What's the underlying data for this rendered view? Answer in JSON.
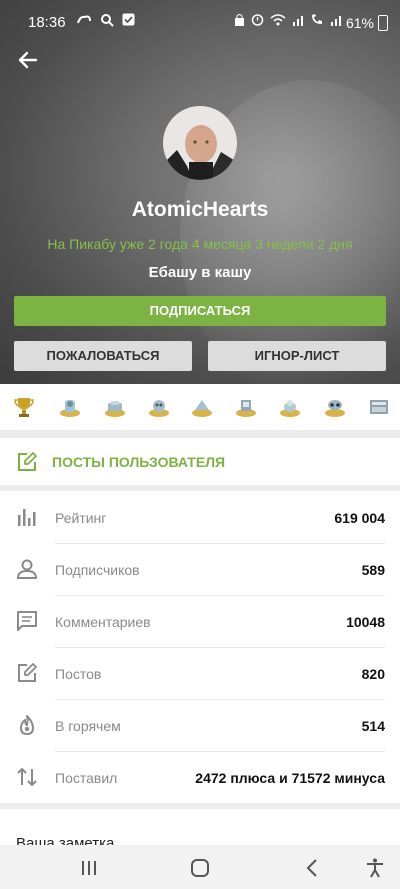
{
  "status": {
    "time": "18:36",
    "battery": "61%"
  },
  "profile": {
    "username": "AtomicHearts",
    "since": "На Пикабу уже 2 года 4 месяца 3 недели 2 дня",
    "motto": "Ебашу в кашу"
  },
  "buttons": {
    "subscribe": "ПОДПИСАТЬСЯ",
    "report": "ПОЖАЛОВАТЬСЯ",
    "ignore": "ИГНОР-ЛИСТ"
  },
  "awards": [
    "trophy-icon",
    "award-icon",
    "award-icon",
    "award-icon",
    "award-icon",
    "award-icon",
    "award-icon",
    "award-icon",
    "award-icon"
  ],
  "posts_link": "ПОСТЫ ПОЛЬЗОВАТЕЛЯ",
  "stats": [
    {
      "label": "Рейтинг",
      "value": "619 004",
      "icon": "rating-icon"
    },
    {
      "label": "Подписчиков",
      "value": "589",
      "icon": "user-icon"
    },
    {
      "label": "Комментариев",
      "value": "10048",
      "icon": "comment-icon"
    },
    {
      "label": "Постов",
      "value": "820",
      "icon": "edit-icon"
    },
    {
      "label": "В горячем",
      "value": "514",
      "icon": "fire-icon"
    },
    {
      "label": "Поставил",
      "value": "2472 плюса и 71572 минуса",
      "icon": "sort-arrows-icon"
    }
  ],
  "notes_label": "Ваша заметка",
  "colors": {
    "accent": "#7cb342",
    "since_text": "#86c049"
  }
}
